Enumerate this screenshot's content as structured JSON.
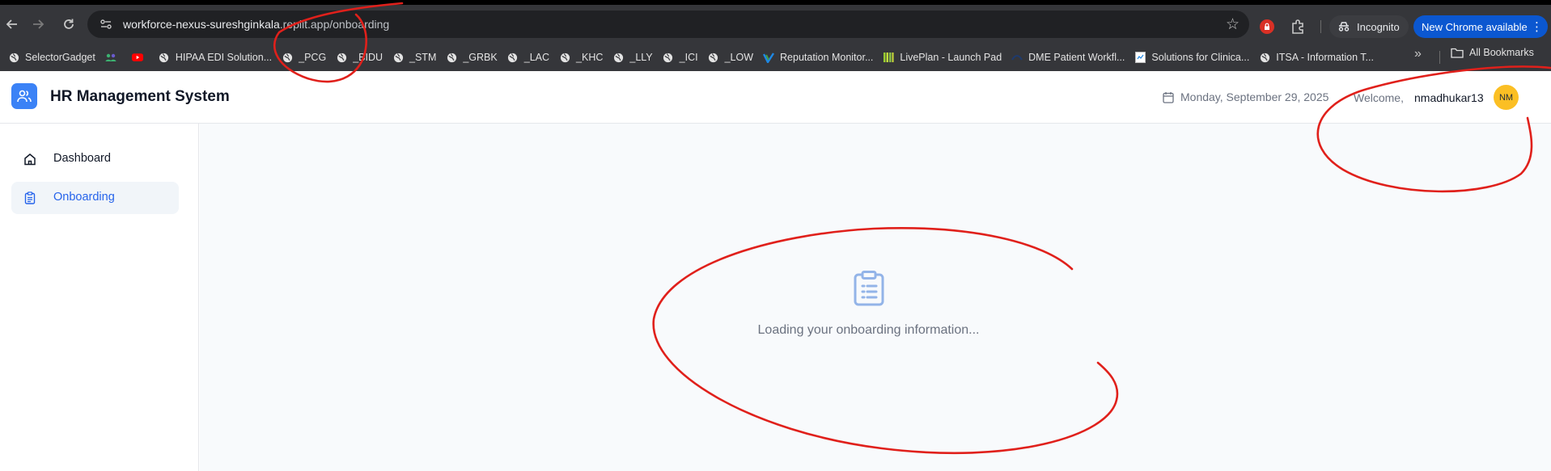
{
  "browser": {
    "url_host": "workforce-nexus-sureshginkala",
    "url_rest": ".replit.app/onboarding",
    "incognito_label": "Incognito",
    "update_label": "New Chrome available",
    "all_bookmarks_label": "All Bookmarks",
    "bookmarks": [
      {
        "label": "SelectorGadget",
        "icon": "globe-icon"
      },
      {
        "label": "",
        "icon": "people-icon"
      },
      {
        "label": "",
        "icon": "youtube-icon"
      },
      {
        "label": "HIPAA EDI Solution...",
        "icon": "globe-icon"
      },
      {
        "label": "_PCG",
        "icon": "globe-icon"
      },
      {
        "label": "_BIDU",
        "icon": "globe-icon"
      },
      {
        "label": "_STM",
        "icon": "globe-icon"
      },
      {
        "label": "_GRBK",
        "icon": "globe-icon"
      },
      {
        "label": "_LAC",
        "icon": "globe-icon"
      },
      {
        "label": "_KHC",
        "icon": "globe-icon"
      },
      {
        "label": "_LLY",
        "icon": "globe-icon"
      },
      {
        "label": "_ICI",
        "icon": "globe-icon"
      },
      {
        "label": "_LOW",
        "icon": "globe-icon"
      },
      {
        "label": "Reputation Monitor...",
        "icon": "checkmark-icon"
      },
      {
        "label": "LivePlan - Launch Pad",
        "icon": "bars-icon"
      },
      {
        "label": "DME Patient Workfl...",
        "icon": "globe-icon"
      },
      {
        "label": "Solutions for Clinica...",
        "icon": "page-icon"
      },
      {
        "label": "ITSA - Information T...",
        "icon": "globe-icon"
      }
    ]
  },
  "header": {
    "title": "HR Management System",
    "date": "Monday, September 29, 2025",
    "welcome": "Welcome,",
    "username": "nmadhukar13",
    "avatar_initials": "NM"
  },
  "sidebar": {
    "items": [
      {
        "label": "Dashboard",
        "icon": "home-icon",
        "active": false
      },
      {
        "label": "Onboarding",
        "icon": "clipboard-icon",
        "active": true
      }
    ]
  },
  "main": {
    "loading_text": "Loading your onboarding information..."
  },
  "colors": {
    "accent": "#3b82f6",
    "active_text": "#2563eb",
    "avatar": "#fbbf24",
    "annotation": "#e0201b"
  }
}
